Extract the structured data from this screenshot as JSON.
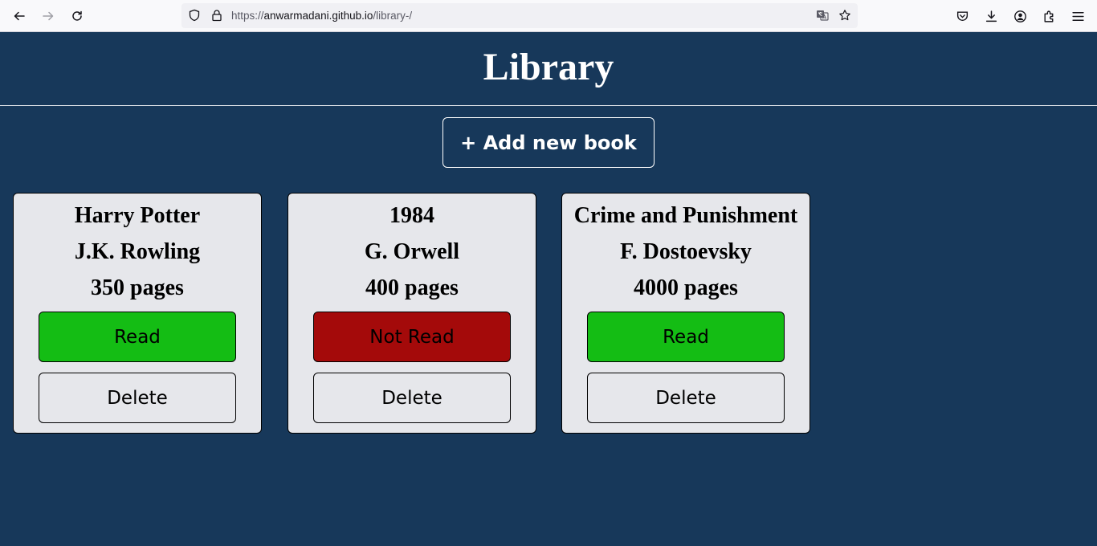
{
  "browser": {
    "url_prefix": "https://",
    "url_host": "anwarmadani.github.io",
    "url_path": "/library-/"
  },
  "page": {
    "title": "Library",
    "add_button_label": "+ Add new book"
  },
  "colors": {
    "background": "#17385a",
    "card": "#e6e7eb",
    "read": "#14bd14",
    "not_read": "#a40a0a"
  },
  "books": [
    {
      "title": "Harry Potter",
      "author": "J.K. Rowling",
      "pages": "350 pages",
      "status": "Read",
      "read": true,
      "delete_label": "Delete"
    },
    {
      "title": "1984",
      "author": "G. Orwell",
      "pages": "400 pages",
      "status": "Not Read",
      "read": false,
      "delete_label": "Delete"
    },
    {
      "title": "Crime and Punishment",
      "author": "F. Dostoevsky",
      "pages": "4000 pages",
      "status": "Read",
      "read": true,
      "delete_label": "Delete"
    }
  ]
}
